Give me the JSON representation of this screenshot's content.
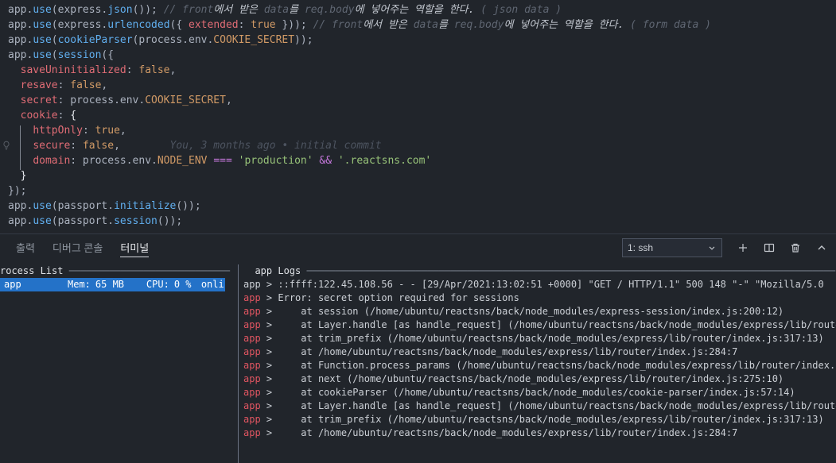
{
  "theme": {
    "background": "#21252b",
    "text": "#abb2bf",
    "accent_blue": "#61afef",
    "prop_red": "#e06c75",
    "const_orange": "#d19a66",
    "string_green": "#98c379",
    "operator_purple": "#c678dd",
    "comment_gray": "#5f6672",
    "selection_blue": "#2472c8",
    "error_red": "#e05561",
    "terminal_text": "#ccd0d6"
  },
  "editor": {
    "blame_annotation": "You, 3 months ago • initial commit",
    "lines": [
      [
        [
          "pl",
          "app."
        ],
        [
          "fn",
          "use"
        ],
        [
          "pl",
          "(express."
        ],
        [
          "fn",
          "json"
        ],
        [
          "pl",
          "()); "
        ],
        [
          "cm",
          "// front"
        ],
        [
          "ck",
          "에서 받은 "
        ],
        [
          "cm",
          "data"
        ],
        [
          "ck",
          "를 "
        ],
        [
          "cm",
          "req.body"
        ],
        [
          "ck",
          "에 넣어주는 역할을 한다. "
        ],
        [
          "cm",
          "( json data )"
        ]
      ],
      [
        [
          "pl",
          "app."
        ],
        [
          "fn",
          "use"
        ],
        [
          "pl",
          "(express."
        ],
        [
          "fn",
          "urlencoded"
        ],
        [
          "pl",
          "({ "
        ],
        [
          "pr",
          "extended"
        ],
        [
          "pl",
          ": "
        ],
        [
          "ct",
          "true"
        ],
        [
          "pl",
          " })); "
        ],
        [
          "cm",
          "// front"
        ],
        [
          "ck",
          "에서 받은 "
        ],
        [
          "cm",
          "data"
        ],
        [
          "ck",
          "를 "
        ],
        [
          "cm",
          "req.body"
        ],
        [
          "ck",
          "에 넣어주는 역할을 한다. "
        ],
        [
          "cm",
          "( form data )"
        ]
      ],
      [
        [
          "pl",
          "app."
        ],
        [
          "fn",
          "use"
        ],
        [
          "pl",
          "("
        ],
        [
          "fn",
          "cookieParser"
        ],
        [
          "pl",
          "(process.env."
        ],
        [
          "ct",
          "COOKIE_SECRET"
        ],
        [
          "pl",
          "));"
        ]
      ],
      [
        [
          "pl",
          "app."
        ],
        [
          "fn",
          "use"
        ],
        [
          "pl",
          "("
        ],
        [
          "fn",
          "session"
        ],
        [
          "pl",
          "({"
        ]
      ],
      [
        [
          "pl",
          "  "
        ],
        [
          "pr",
          "saveUninitialized"
        ],
        [
          "pl",
          ": "
        ],
        [
          "ct",
          "false"
        ],
        [
          "pl",
          ","
        ]
      ],
      [
        [
          "pl",
          "  "
        ],
        [
          "pr",
          "resave"
        ],
        [
          "pl",
          ": "
        ],
        [
          "ct",
          "false"
        ],
        [
          "pl",
          ","
        ]
      ],
      [
        [
          "pl",
          "  "
        ],
        [
          "pr",
          "secret"
        ],
        [
          "pl",
          ": process.env."
        ],
        [
          "ct",
          "COOKIE_SECRET"
        ],
        [
          "pl",
          ","
        ]
      ],
      [
        [
          "pl",
          "  "
        ],
        [
          "pr",
          "cookie"
        ],
        [
          "pl",
          ": "
        ],
        [
          "bk",
          "{"
        ]
      ],
      [
        [
          "pl",
          "    "
        ],
        [
          "pr",
          "httpOnly"
        ],
        [
          "pl",
          ": "
        ],
        [
          "ct",
          "true"
        ],
        [
          "pl",
          ","
        ]
      ],
      [
        [
          "pl",
          "    "
        ],
        [
          "pr",
          "secure"
        ],
        [
          "pl",
          ": "
        ],
        [
          "ct",
          "false"
        ],
        [
          "pl",
          ","
        ],
        [
          "gh",
          "        You, 3 months ago • initial commit"
        ]
      ],
      [
        [
          "pl",
          "    "
        ],
        [
          "pr",
          "domain"
        ],
        [
          "pl",
          ": process.env."
        ],
        [
          "ct",
          "NODE_ENV"
        ],
        [
          "pl",
          " "
        ],
        [
          "op",
          "==="
        ],
        [
          "pl",
          " "
        ],
        [
          "st",
          "'production'"
        ],
        [
          "pl",
          " "
        ],
        [
          "op",
          "&&"
        ],
        [
          "pl",
          " "
        ],
        [
          "st",
          "'.reactsns.com'"
        ]
      ],
      [
        [
          "pl",
          "  "
        ],
        [
          "bk",
          "}"
        ]
      ],
      [
        [
          "pl",
          "});"
        ]
      ],
      [
        [
          "pl",
          "app."
        ],
        [
          "fn",
          "use"
        ],
        [
          "pl",
          "(passport."
        ],
        [
          "fn",
          "initialize"
        ],
        [
          "pl",
          "());"
        ]
      ],
      [
        [
          "pl",
          "app."
        ],
        [
          "fn",
          "use"
        ],
        [
          "pl",
          "(passport."
        ],
        [
          "fn",
          "session"
        ],
        [
          "pl",
          "());"
        ]
      ]
    ]
  },
  "panel": {
    "tabs": [
      {
        "id": "output",
        "label": "출력",
        "active": false
      },
      {
        "id": "debug-console",
        "label": "디버그 콘솔",
        "active": false
      },
      {
        "id": "terminal",
        "label": "터미널",
        "active": true
      }
    ],
    "terminal_picker": {
      "value": "1: ssh"
    },
    "icons": {
      "picker_chevron": "chevron-down-icon",
      "new_terminal": "plus-icon",
      "split_terminal": "split-icon",
      "kill_terminal": "trash-icon",
      "maximize_panel": "chevron-up-icon"
    }
  },
  "terminal": {
    "process_list": {
      "header": "rocess List ",
      "header_dashes": "────────────────────────────",
      "row": {
        "name": "app",
        "mem_label": "Mem:",
        "mem_value": "65 MB",
        "cpu_label": "CPU:",
        "cpu_value": "0 %",
        "status": "onli"
      }
    },
    "logs": {
      "header": "  app Logs ",
      "header_dashes": "────────────────────────────────────────────────────────────────────────────────────────────",
      "lines": [
        {
          "name": "app",
          "err": false,
          "msg": "::ffff:122.45.108.56 - - [29/Apr/2021:13:02:51 +0000] \"GET / HTTP/1.1\" 500 148 \"-\" \"Mozilla/5.0"
        },
        {
          "name": "app",
          "err": true,
          "msg": "Error: secret option required for sessions"
        },
        {
          "name": "app",
          "err": true,
          "msg": "    at session (/home/ubuntu/reactsns/back/node_modules/express-session/index.js:200:12)"
        },
        {
          "name": "app",
          "err": true,
          "msg": "    at Layer.handle [as handle_request] (/home/ubuntu/reactsns/back/node_modules/express/lib/route"
        },
        {
          "name": "app",
          "err": true,
          "msg": "    at trim_prefix (/home/ubuntu/reactsns/back/node_modules/express/lib/router/index.js:317:13)"
        },
        {
          "name": "app",
          "err": true,
          "msg": "    at /home/ubuntu/reactsns/back/node_modules/express/lib/router/index.js:284:7"
        },
        {
          "name": "app",
          "err": true,
          "msg": "    at Function.process_params (/home/ubuntu/reactsns/back/node_modules/express/lib/router/index.j"
        },
        {
          "name": "app",
          "err": true,
          "msg": "    at next (/home/ubuntu/reactsns/back/node_modules/express/lib/router/index.js:275:10)"
        },
        {
          "name": "app",
          "err": true,
          "msg": "    at cookieParser (/home/ubuntu/reactsns/back/node_modules/cookie-parser/index.js:57:14)"
        },
        {
          "name": "app",
          "err": true,
          "msg": "    at Layer.handle [as handle_request] (/home/ubuntu/reactsns/back/node_modules/express/lib/route"
        },
        {
          "name": "app",
          "err": true,
          "msg": "    at trim_prefix (/home/ubuntu/reactsns/back/node_modules/express/lib/router/index.js:317:13)"
        },
        {
          "name": "app",
          "err": true,
          "msg": "    at /home/ubuntu/reactsns/back/node_modules/express/lib/router/index.js:284:7"
        }
      ]
    }
  }
}
